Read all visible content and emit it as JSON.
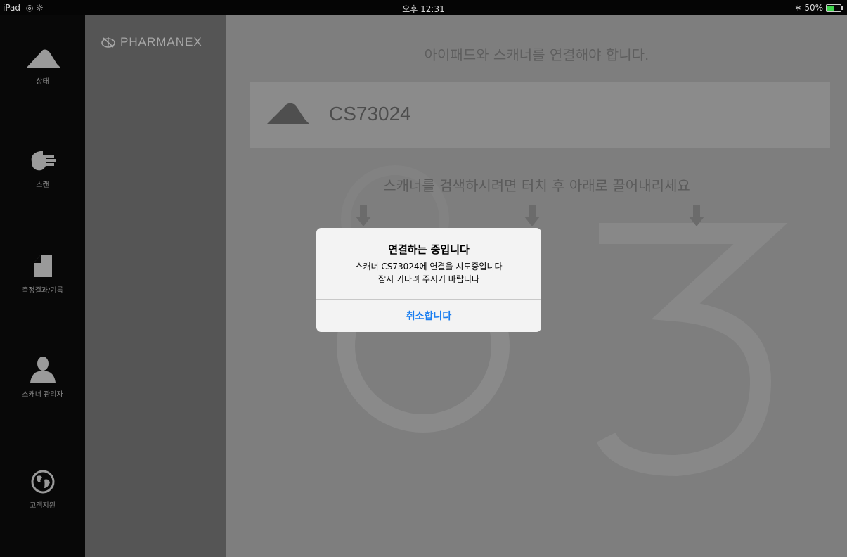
{
  "status_bar": {
    "device": "iPad",
    "time": "오후 12:31",
    "battery_percent": "50%",
    "battery_level": 0.5
  },
  "nav": {
    "items": [
      {
        "label": "상태",
        "icon": "scanner-icon"
      },
      {
        "label": "스캔",
        "icon": "hand-icon"
      },
      {
        "label": "측정결과/기록",
        "icon": "document-icon"
      },
      {
        "label": "스캐너 관리자",
        "icon": "user-icon"
      },
      {
        "label": "고객지원",
        "icon": "globe-icon"
      }
    ]
  },
  "brand": {
    "name": "PHARMANEX"
  },
  "main": {
    "title": "아이패드와 스캐너를 연결해야 합니다.",
    "scanner_name": "CS73024",
    "hint": "스캐너를 검색하시려면 터치 후 아래로 끌어내리세요"
  },
  "dialog": {
    "title": "연결하는 중입니다",
    "message_line1": "스캐너 CS73024에 연결을 시도중입니다",
    "message_line2": "잠시 기다려 주시기 바랍니다",
    "cancel_label": "취소합니다"
  },
  "colors": {
    "accent": "#1a7ef0",
    "battery": "#3fd34d"
  }
}
